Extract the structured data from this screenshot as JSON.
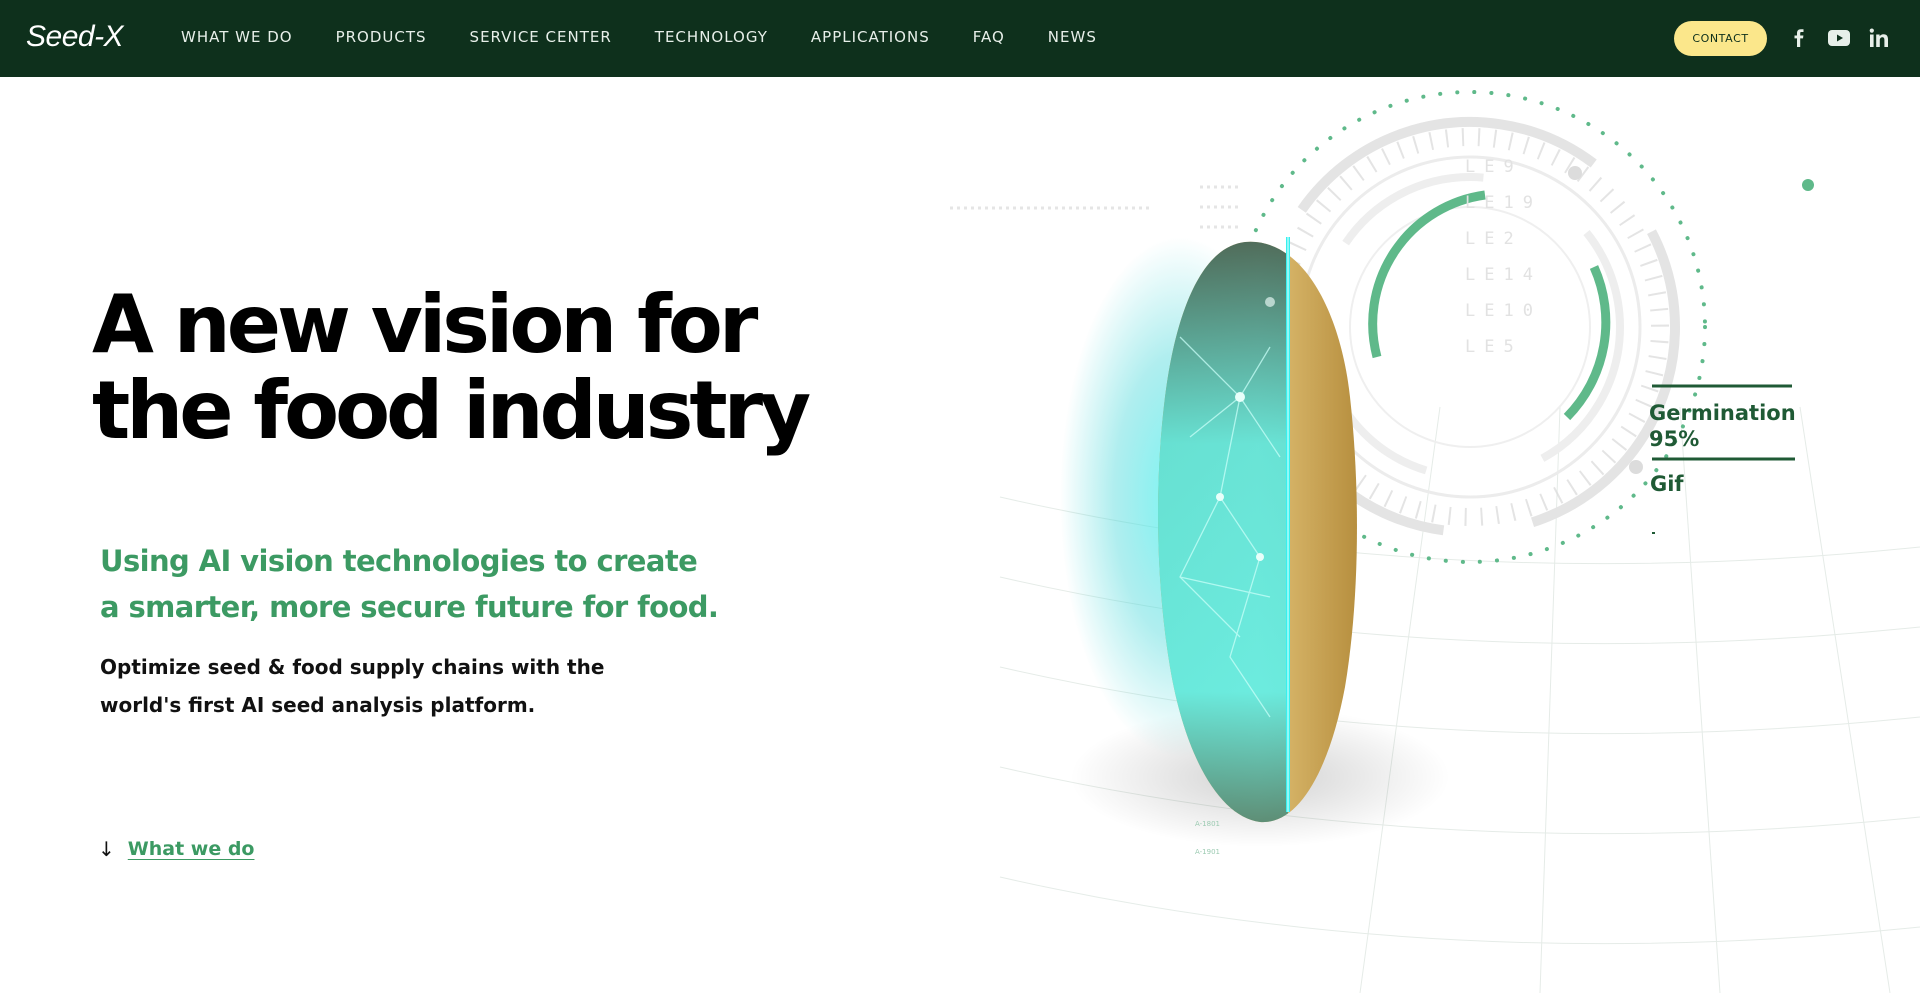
{
  "nav": {
    "logo": "Seed-X",
    "links": [
      "WHAT WE DO",
      "PRODUCTS",
      "SERVICE CENTER",
      "TECHNOLOGY",
      "APPLICATIONS",
      "FAQ",
      "NEWS"
    ],
    "contact_label": "CONTACT",
    "social_icons": [
      "facebook-icon",
      "youtube-icon",
      "linkedin-icon"
    ]
  },
  "hero": {
    "title_lines": [
      "A new vision for",
      "the food industry"
    ],
    "subtitle_lines": [
      "Using AI vision technologies to create",
      "a smarter, more secure future for food."
    ],
    "body_lines": [
      "Optimize seed & food supply chains with the",
      "world's first AI seed analysis platform."
    ],
    "cta_label": "What we do"
  },
  "illustration": {
    "germination_label": "Germination",
    "germination_value": "95%",
    "secondary_label": "Gif",
    "scan_codes": [
      "LE9",
      "LE19",
      "LE2",
      "LE14",
      "LE10",
      "LE5"
    ],
    "small_codes": [
      "A-1801",
      "A-1901"
    ]
  },
  "colors": {
    "nav_bg": "#0e301c",
    "accent_green": "#3c9a63",
    "contact_bg": "#fbe78b",
    "scan_cyan": "#38f0ee"
  }
}
